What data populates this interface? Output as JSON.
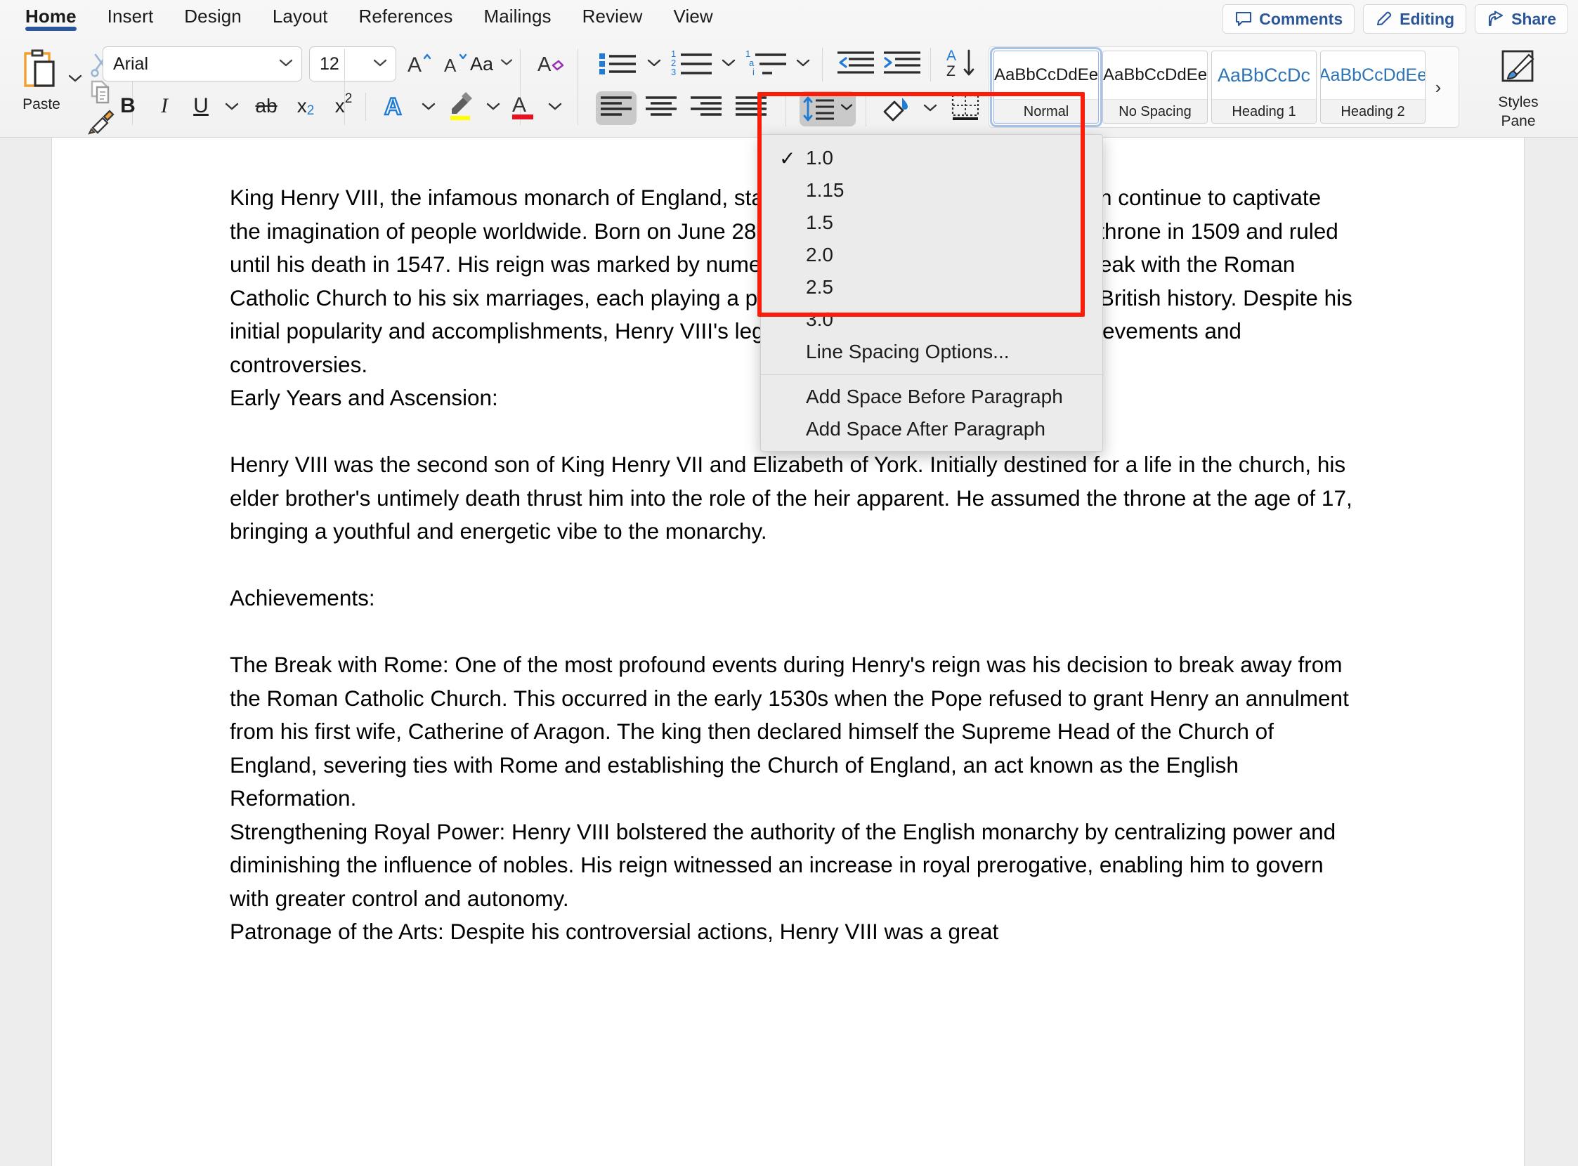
{
  "ribbon": {
    "tabs": [
      {
        "label": "Home",
        "active": true
      },
      {
        "label": "Insert",
        "active": false
      },
      {
        "label": "Design",
        "active": false
      },
      {
        "label": "Layout",
        "active": false
      },
      {
        "label": "References",
        "active": false
      },
      {
        "label": "Mailings",
        "active": false
      },
      {
        "label": "Review",
        "active": false
      },
      {
        "label": "View",
        "active": false
      }
    ],
    "top_right_buttons": [
      {
        "label": "Comments",
        "icon": "comment-icon"
      },
      {
        "label": "Editing",
        "icon": "pencil-icon"
      },
      {
        "label": "Share",
        "icon": "share-icon"
      }
    ],
    "accent_color": "#2b579a",
    "annotation_color": "#f91d0a"
  },
  "clipboard": {
    "paste_label": "Paste",
    "cut_icon": "scissors-icon",
    "copy_icon": "copy-icon",
    "format_painter_icon": "format-painter-icon"
  },
  "font_group": {
    "font_name": "Arial",
    "font_size": "12",
    "grow_font_icon": "grow-font-icon",
    "shrink_font_icon": "shrink-font-icon",
    "change_case_label": "Aa",
    "clear_formatting_icon": "clear-formatting-icon",
    "bold_label": "B",
    "italic_label": "I",
    "underline_label": "U",
    "strikethrough_label": "ab",
    "subscript_label": "x",
    "subscript_sub": "2",
    "superscript_label": "x",
    "superscript_sup": "2",
    "text_effects_label": "A",
    "highlight_icon": "highlighter-icon",
    "highlight_color": "#ffff00",
    "font_color_label": "A",
    "font_color": "#e81123",
    "text_effects_color": "#1f7bd4"
  },
  "paragraph_group": {
    "bullets_icon": "bullets-icon",
    "numbering_icon": "numbering-icon",
    "multilevel_icon": "multilevel-list-icon",
    "decrease_indent_icon": "decrease-indent-icon",
    "increase_indent_icon": "increase-indent-icon",
    "sort_icon": "sort-az-icon",
    "show_marks_label": "¶",
    "align_left_icon": "align-left-icon",
    "align_center_icon": "align-center-icon",
    "align_right_icon": "align-right-icon",
    "justify_icon": "justify-icon",
    "line_spacing_icon": "line-spacing-icon",
    "shading_icon": "shading-icon",
    "borders_icon": "borders-icon",
    "active_alignment": "align-left",
    "line_spacing_active": true
  },
  "styles_gallery": {
    "items": [
      {
        "preview": "AaBbCcDdEe",
        "name": "Normal",
        "selected": true,
        "kind": "normal"
      },
      {
        "preview": "AaBbCcDdEe",
        "name": "No Spacing",
        "selected": false,
        "kind": "normal"
      },
      {
        "preview": "AaBbCcDc",
        "name": "Heading 1",
        "selected": false,
        "kind": "h1"
      },
      {
        "preview": "AaBbCcDdEe",
        "name": "Heading 2",
        "selected": false,
        "kind": "h2"
      }
    ],
    "more_label": "›",
    "styles_pane_label_line1": "Styles",
    "styles_pane_label_line2": "Pane",
    "styles_pane_icon": "styles-pane-brush-icon"
  },
  "line_spacing_menu": {
    "open": true,
    "items": [
      {
        "label": "1.0",
        "checked": true
      },
      {
        "label": "1.15",
        "checked": false
      },
      {
        "label": "1.5",
        "checked": false
      },
      {
        "label": "2.0",
        "checked": false
      },
      {
        "label": "2.5",
        "checked": false
      },
      {
        "label": "3.0",
        "checked": false
      },
      {
        "label": "Line Spacing Options...",
        "checked": false
      }
    ],
    "extra_items": [
      {
        "label": "Add Space Before Paragraph"
      },
      {
        "label": "Add Space After Paragraph"
      }
    ],
    "check_glyph": "✓"
  },
  "document": {
    "paragraphs": [
      "King Henry VIII, the infamous monarch of England, stands as a figure whose life and reign continue to captivate the imagination of people worldwide. Born on June 28, 1491, Henry VIII ascended to the throne in 1509 and ruled until his death in 1547. His reign was marked by numerous significant events, from the break with the Roman Catholic Church to his six marriages, each playing a pivotal role in shaping the course of British history. Despite his initial popularity and accomplishments, Henry VIII's legacy remains a complex mix of achievements and controversies.",
      "Early Years and Ascension:",
      "",
      "Henry VIII was the second son of King Henry VII and Elizabeth of York. Initially destined for a life in the church, his elder brother's untimely death thrust him into the role of the heir apparent. He assumed the throne at the age of 17, bringing a youthful and energetic vibe to the monarchy.",
      "",
      "Achievements:",
      "",
      "The Break with Rome: One of the most profound events during Henry's reign was his decision to break away from the Roman Catholic Church. This occurred in the early 1530s when the Pope refused to grant Henry an annulment from his first wife, Catherine of Aragon. The king then declared himself the Supreme Head of the Church of England, severing ties with Rome and establishing the Church of England, an act known as the English Reformation.",
      "Strengthening Royal Power: Henry VIII bolstered the authority of the English monarchy by centralizing power and diminishing the influence of nobles. His reign witnessed an increase in royal prerogative, enabling him to govern with greater control and autonomy.",
      "Patronage of the Arts: Despite his controversial actions, Henry VIII was a great"
    ]
  }
}
